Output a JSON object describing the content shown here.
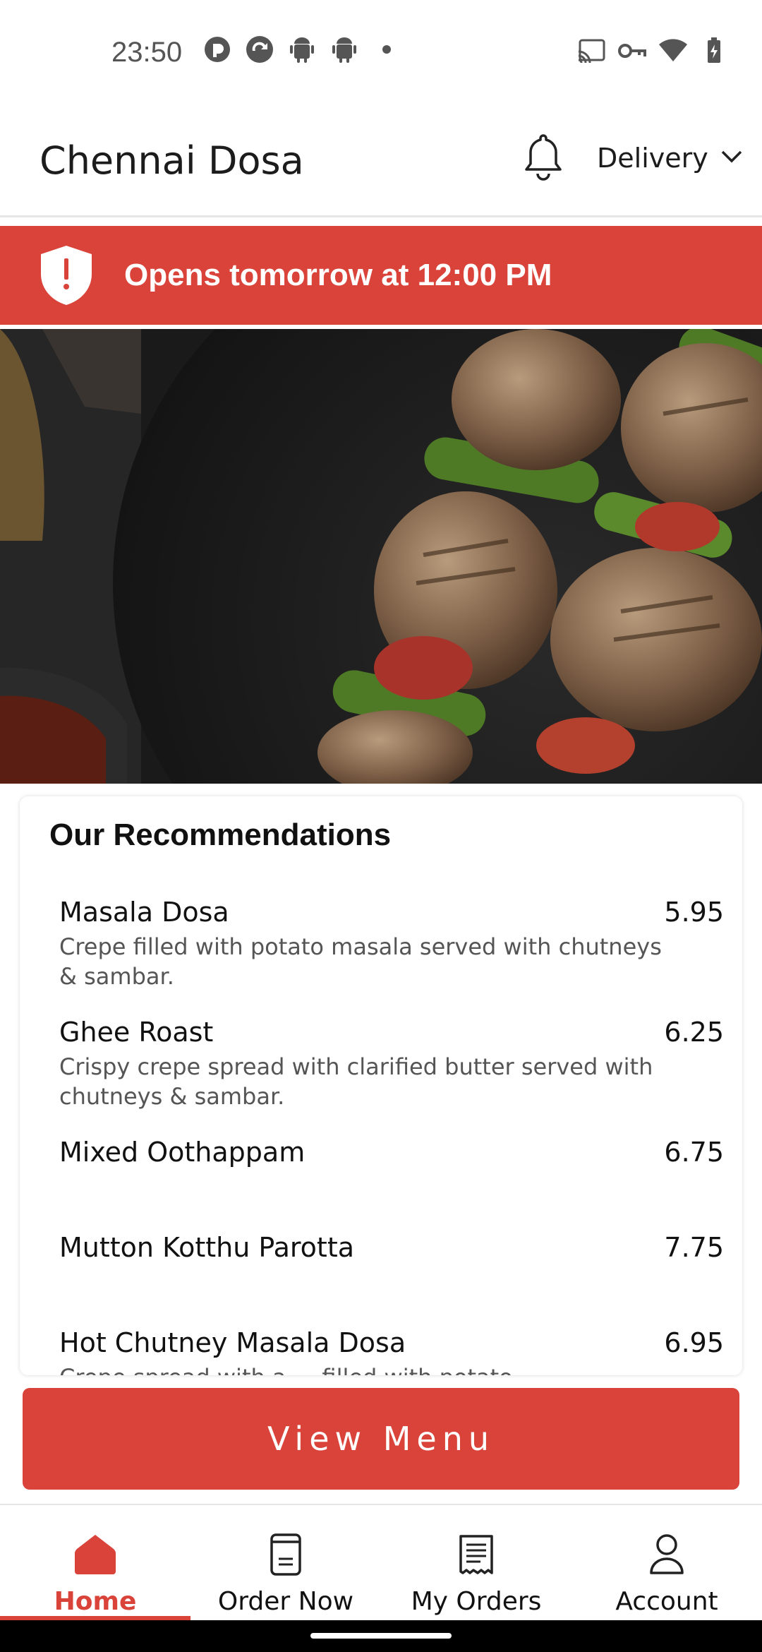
{
  "status_bar": {
    "time": "23:50",
    "left_icons": [
      "pocket-casts-icon",
      "sync-app-icon",
      "android-icon",
      "android-icon",
      "dot-icon"
    ],
    "right_icons": [
      "cast-icon",
      "vpn-key-icon",
      "wifi-icon",
      "battery-charging-icon"
    ]
  },
  "header": {
    "title": "Chennai Dosa",
    "bell_icon": "bell-icon",
    "delivery_label": "Delivery"
  },
  "banner": {
    "text": "Opens tomorrow at 12:00 PM",
    "color": "#d9433a"
  },
  "recommendations": {
    "title": "Our Recommendations",
    "items": [
      {
        "name": "Masala Dosa",
        "price": "5.95",
        "description": "Crepe filled with potato masala served with chutneys & sambar."
      },
      {
        "name": "Ghee Roast",
        "price": "6.25",
        "description": "Crispy crepe spread with clarified butter served with chutneys & sambar."
      },
      {
        "name": "Mixed Oothappam",
        "price": "6.75",
        "description": ""
      },
      {
        "name": "Mutton Kotthu Parotta",
        "price": "7.75",
        "description": ""
      },
      {
        "name": "Hot Chutney Masala Dosa",
        "price": "6.95",
        "description": "Crepe spread with a ... filled with potato"
      }
    ]
  },
  "view_menu_label": "View Menu",
  "bottom_nav": {
    "items": [
      {
        "label": "Home",
        "icon": "home-icon",
        "active": true
      },
      {
        "label": "Order Now",
        "icon": "order-book-icon",
        "active": false
      },
      {
        "label": "My Orders",
        "icon": "receipt-icon",
        "active": false
      },
      {
        "label": "Account",
        "icon": "person-icon",
        "active": false
      }
    ]
  },
  "accent_color": "#d9433a"
}
